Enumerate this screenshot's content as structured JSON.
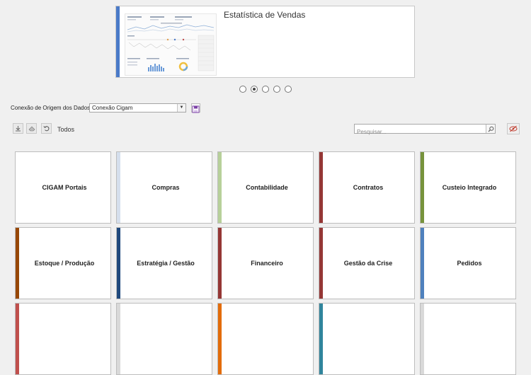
{
  "carousel": {
    "title": "Estatística de Vendas",
    "dots": 5,
    "active_dot": 1,
    "accent_color": "#4a7ac8"
  },
  "connection": {
    "label": "Conexão de Origem dos Dados",
    "value": "Conexão Cigam"
  },
  "toolbar": {
    "filter_label": "Todos",
    "search_placeholder": "Pesquisar..."
  },
  "tiles": [
    {
      "label": "CIGAM Portais",
      "color": ""
    },
    {
      "label": "Compras",
      "color": "#d5dfed"
    },
    {
      "label": "Contabilidade",
      "color": "#b7d09a"
    },
    {
      "label": "Contratos",
      "color": "#953735"
    },
    {
      "label": "Custeio Integrado",
      "color": "#77933c"
    },
    {
      "label": "Estoque / Produção",
      "color": "#974706"
    },
    {
      "label": "Estratégia / Gestão",
      "color": "#1f497d"
    },
    {
      "label": "Financeiro",
      "color": "#953735"
    },
    {
      "label": "Gestão da Crise",
      "color": "#953735"
    },
    {
      "label": "Pedidos",
      "color": "#4f81bd"
    },
    {
      "label": "",
      "color": "#c0504d"
    },
    {
      "label": "",
      "color": "#d9d9d9"
    },
    {
      "label": "",
      "color": "#e36c09"
    },
    {
      "label": "",
      "color": "#31859c"
    },
    {
      "label": "",
      "color": "#d9d9d9"
    }
  ]
}
